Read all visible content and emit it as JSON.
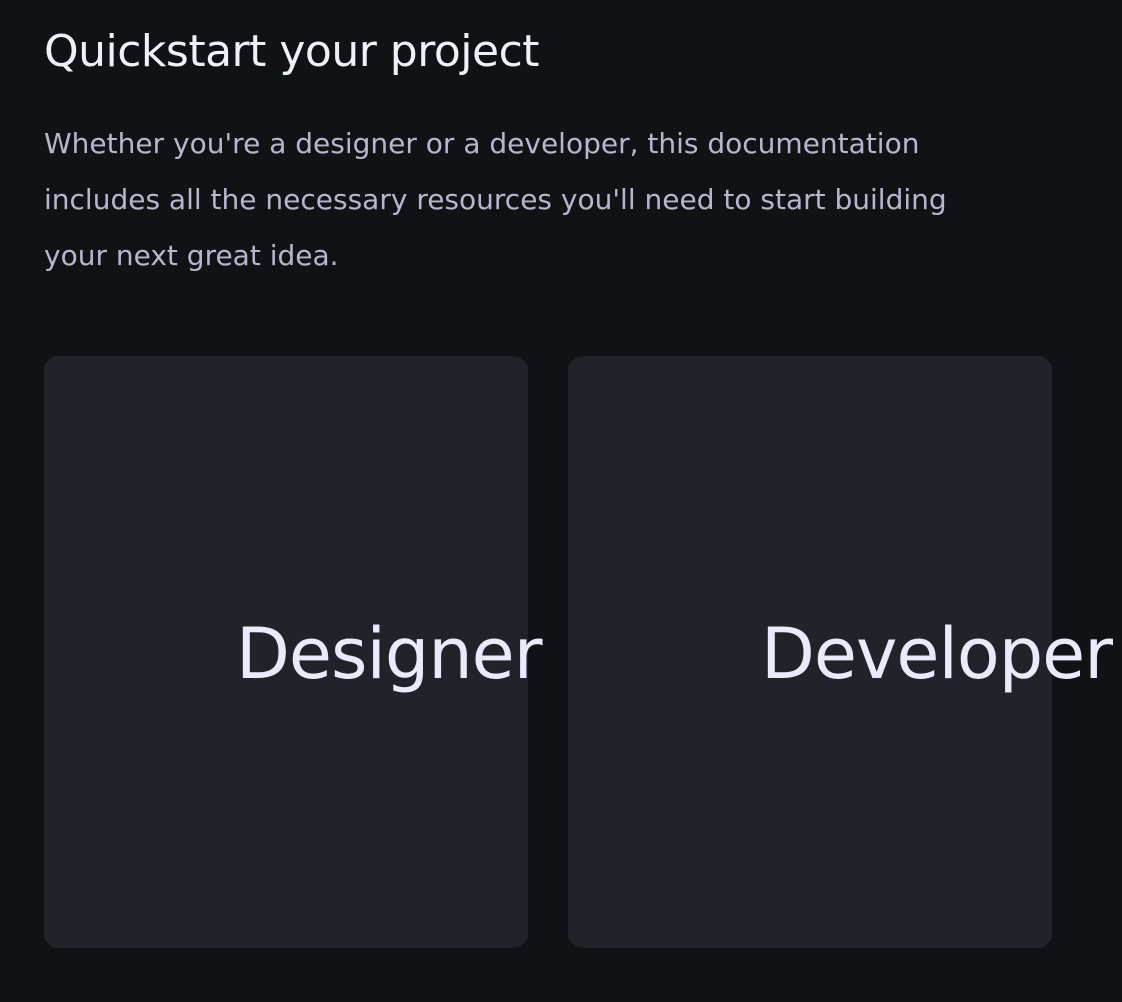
{
  "page": {
    "title": "Quickstart your project",
    "intro_lines": [
      "Whether you're a designer or a developer, this documentation",
      "includes all the necessary resources you'll need to start building",
      "your next great idea."
    ]
  },
  "cards": [
    {
      "label": "Designer"
    },
    {
      "label": "Developer"
    }
  ],
  "colors": {
    "background": "#111216",
    "card": "#21232b",
    "heading_text": "#eef0fa",
    "body_text": "#b3b8cc",
    "card_text": "#e8ebfa"
  }
}
